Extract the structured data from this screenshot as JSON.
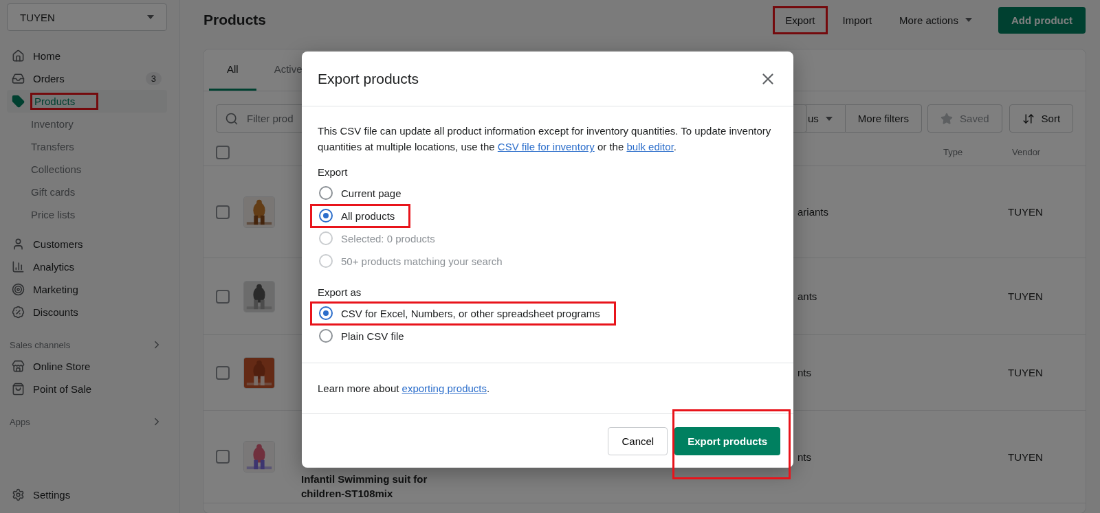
{
  "store": {
    "name": "TUYEN"
  },
  "nav": [
    {
      "kind": "main",
      "label": "Home",
      "selected": false
    },
    {
      "kind": "main",
      "label": "Orders",
      "badge": "3",
      "selected": false
    },
    {
      "kind": "main",
      "label": "Products",
      "selected": true,
      "highlighted": true
    },
    {
      "kind": "sub",
      "label": "Inventory",
      "selected": false
    },
    {
      "kind": "sub",
      "label": "Transfers",
      "selected": false
    },
    {
      "kind": "sub",
      "label": "Collections",
      "selected": false
    },
    {
      "kind": "sub",
      "label": "Gift cards",
      "selected": false
    },
    {
      "kind": "sub",
      "label": "Price lists",
      "selected": false
    },
    {
      "kind": "main",
      "label": "Customers",
      "selected": false
    },
    {
      "kind": "main",
      "label": "Analytics",
      "selected": false
    },
    {
      "kind": "main",
      "label": "Marketing",
      "selected": false
    },
    {
      "kind": "main",
      "label": "Discounts",
      "selected": false
    },
    {
      "kind": "section",
      "label": "Sales channels"
    },
    {
      "kind": "main",
      "label": "Online Store",
      "selected": false
    },
    {
      "kind": "main",
      "label": "Point of Sale",
      "selected": false
    },
    {
      "kind": "section",
      "label": "Apps"
    }
  ],
  "settings": {
    "label": "Settings"
  },
  "header": {
    "title": "Products",
    "actions": [
      {
        "kind": "plain",
        "label": "Export",
        "highlighted": true
      },
      {
        "kind": "plain",
        "label": "Import",
        "highlighted": false
      },
      {
        "kind": "menu",
        "label": "More actions",
        "highlighted": false
      }
    ],
    "primary": "Add product"
  },
  "tabs": [
    {
      "label": "All",
      "selected": true
    },
    {
      "label": "Active",
      "selected": false
    }
  ],
  "filters": {
    "placeholder": "Filter prod",
    "status": "us",
    "more": "More filters",
    "saved": {
      "label": "Saved",
      "disabled": true
    },
    "sort": "Sort"
  },
  "table": {
    "select_all": {
      "checked": false
    },
    "columns": [
      "Type",
      "Vendor"
    ],
    "rows": [
      {
        "variants": "ariants",
        "vendor": "TUYEN",
        "checked": false
      },
      {
        "variants": "ants",
        "vendor": "TUYEN",
        "checked": false
      },
      {
        "variants": "nts",
        "vendor": "TUYEN",
        "checked": false
      },
      {
        "title": "Infantil Swimming suit for children-ST108mix",
        "variants": "nts",
        "vendor": "TUYEN",
        "checked": false
      }
    ]
  },
  "dialog": {
    "title": "Export products",
    "description": "This CSV file can update all product information except for inventory quantities. To update inventory quantities at multiple locations, use the ",
    "link1": "CSV file for inventory",
    "between": " or the ",
    "link2": "bulk editor",
    "after": ".",
    "groups": [
      {
        "label": "Export",
        "options": [
          {
            "label": "Current page",
            "selected": false,
            "disabled": false,
            "highlighted": false
          },
          {
            "label": "All products",
            "selected": true,
            "disabled": false,
            "highlighted": true
          },
          {
            "label": "Selected: 0 products",
            "selected": false,
            "disabled": true,
            "highlighted": false
          },
          {
            "label": "50+ products matching your search",
            "selected": false,
            "disabled": true,
            "highlighted": false
          }
        ]
      },
      {
        "label": "Export as",
        "options": [
          {
            "label": "CSV for Excel, Numbers, or other spreadsheet programs",
            "selected": true,
            "disabled": false,
            "highlighted": true
          },
          {
            "label": "Plain CSV file",
            "selected": false,
            "disabled": false,
            "highlighted": false
          }
        ]
      }
    ],
    "learn": "Learn more about ",
    "learn_link": "exporting products",
    "learn_after": ".",
    "cancel": "Cancel",
    "confirm": {
      "label": "Export products",
      "highlighted": true
    }
  }
}
